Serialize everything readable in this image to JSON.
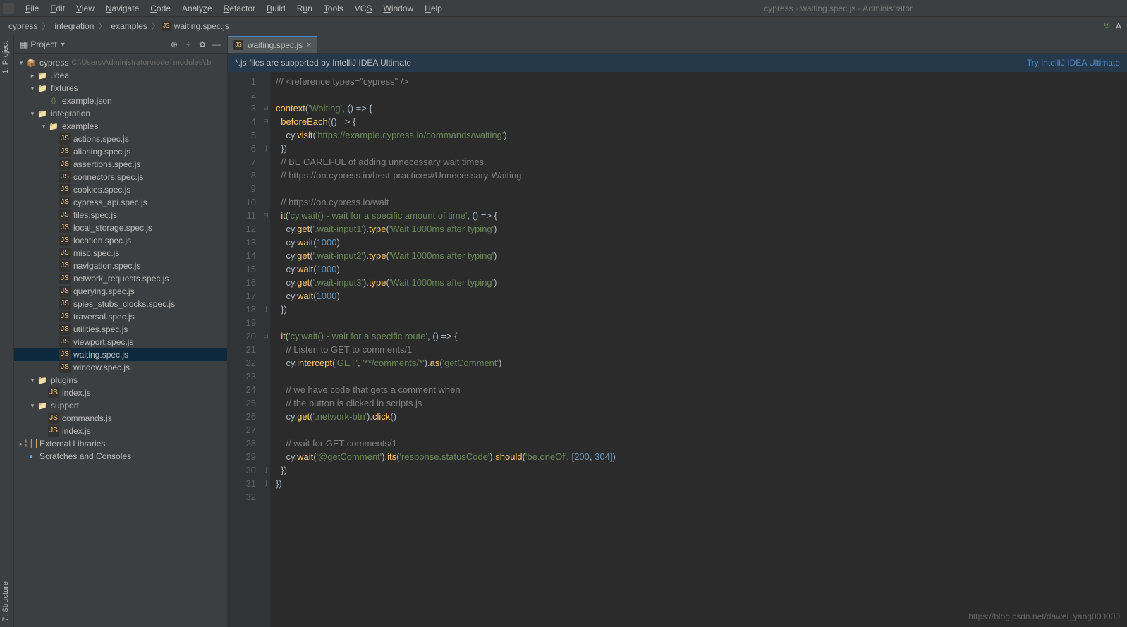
{
  "window_title": "cypress - waiting.spec.js - Administrator",
  "menu": [
    "File",
    "Edit",
    "View",
    "Navigate",
    "Code",
    "Analyze",
    "Refactor",
    "Build",
    "Run",
    "Tools",
    "VCS",
    "Window",
    "Help"
  ],
  "breadcrumb": [
    "cypress",
    "integration",
    "examples",
    "waiting.spec.js"
  ],
  "project_panel": {
    "title": "Project"
  },
  "tree": {
    "root": {
      "name": "cypress",
      "hint": "C:\\Users\\Administrator\\node_modules\\.b"
    },
    "idea": ".idea",
    "fixtures": "fixtures",
    "example_json": "example.json",
    "integration": "integration",
    "examples": "examples",
    "files": [
      "actions.spec.js",
      "aliasing.spec.js",
      "assertions.spec.js",
      "connectors.spec.js",
      "cookies.spec.js",
      "cypress_api.spec.js",
      "files.spec.js",
      "local_storage.spec.js",
      "location.spec.js",
      "misc.spec.js",
      "navigation.spec.js",
      "network_requests.spec.js",
      "querying.spec.js",
      "spies_stubs_clocks.spec.js",
      "traversal.spec.js",
      "utilities.spec.js",
      "viewport.spec.js",
      "waiting.spec.js",
      "window.spec.js"
    ],
    "plugins": "plugins",
    "plugins_index": "index.js",
    "support": "support",
    "support_commands": "commands.js",
    "support_index": "index.js",
    "ext_lib": "External Libraries",
    "scratches": "Scratches and Consoles"
  },
  "tab": {
    "name": "waiting.spec.js"
  },
  "notification": {
    "text": "*.js files are supported by IntelliJ IDEA Ultimate",
    "link": "Try IntelliJ IDEA Ultimate"
  },
  "left_gutter": {
    "project": "1: Project",
    "structure": "7: Structure"
  },
  "code_lines": 32,
  "watermark": "https://blog.csdn.net/dawei_yang000000"
}
